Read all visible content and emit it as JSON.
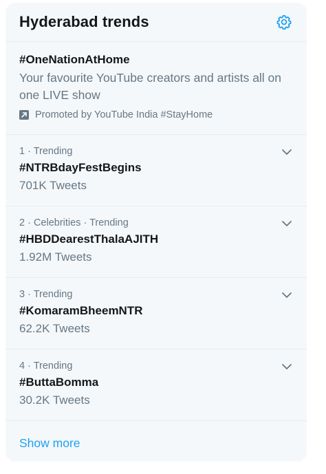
{
  "header": {
    "title": "Hyderabad trends",
    "settings_icon": "gear-icon"
  },
  "promoted": {
    "tag": "#OneNationAtHome",
    "description": "Your favourite YouTube creators and artists all on one LIVE show",
    "promoted_by": "Promoted by YouTube India #StayHome",
    "icon": "promoted-arrow-icon"
  },
  "trends": [
    {
      "meta": "1 · Trending",
      "name": "#NTRBdayFestBegins",
      "count": "701K Tweets"
    },
    {
      "meta": "2 · Celebrities · Trending",
      "name": "#HBDDearestThalaAJITH",
      "count": "1.92M Tweets"
    },
    {
      "meta": "3 · Trending",
      "name": "#KomaramBheemNTR",
      "count": "62.2K Tweets"
    },
    {
      "meta": "4 · Trending",
      "name": "#ButtaBomma",
      "count": "30.2K Tweets"
    }
  ],
  "footer": {
    "show_more": "Show more"
  },
  "colors": {
    "accent": "#1da1f2",
    "background": "#f5f8fa",
    "secondary_text": "#657786",
    "primary_text": "#14171a"
  }
}
